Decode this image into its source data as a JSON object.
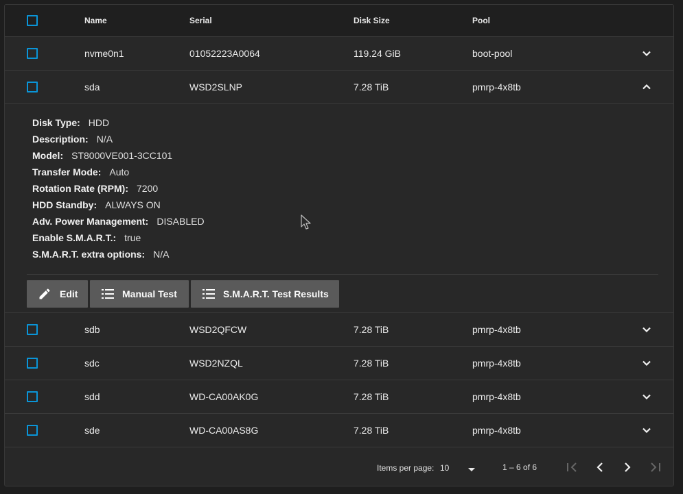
{
  "table": {
    "headers": {
      "name": "Name",
      "serial": "Serial",
      "disk_size": "Disk Size",
      "pool": "Pool"
    },
    "rows": [
      {
        "name": "nvme0n1",
        "serial": "01052223A0064",
        "disk_size": "119.24 GiB",
        "pool": "boot-pool",
        "expanded": false
      },
      {
        "name": "sda",
        "serial": "WSD2SLNP",
        "disk_size": "7.28 TiB",
        "pool": "pmrp-4x8tb",
        "expanded": true
      },
      {
        "name": "sdb",
        "serial": "WSD2QFCW",
        "disk_size": "7.28 TiB",
        "pool": "pmrp-4x8tb",
        "expanded": false
      },
      {
        "name": "sdc",
        "serial": "WSD2NZQL",
        "disk_size": "7.28 TiB",
        "pool": "pmrp-4x8tb",
        "expanded": false
      },
      {
        "name": "sdd",
        "serial": "WD-CA00AK0G",
        "disk_size": "7.28 TiB",
        "pool": "pmrp-4x8tb",
        "expanded": false
      },
      {
        "name": "sde",
        "serial": "WD-CA00AS8G",
        "disk_size": "7.28 TiB",
        "pool": "pmrp-4x8tb",
        "expanded": false
      }
    ]
  },
  "details": [
    {
      "key": "Disk Type:",
      "value": "HDD"
    },
    {
      "key": "Description:",
      "value": "N/A"
    },
    {
      "key": "Model:",
      "value": "ST8000VE001-3CC101"
    },
    {
      "key": "Transfer Mode:",
      "value": "Auto"
    },
    {
      "key": "Rotation Rate (RPM):",
      "value": "7200"
    },
    {
      "key": "HDD Standby:",
      "value": "ALWAYS ON"
    },
    {
      "key": "Adv. Power Management:",
      "value": "DISABLED"
    },
    {
      "key": "Enable S.M.A.R.T.:",
      "value": "true"
    },
    {
      "key": "S.M.A.R.T. extra options:",
      "value": "N/A"
    }
  ],
  "actions": {
    "edit": "Edit",
    "manual_test": "Manual Test",
    "smart_results": "S.M.A.R.T. Test Results"
  },
  "paginator": {
    "items_per_page_label": "Items per page:",
    "page_size": "10",
    "range": "1 – 6 of 6"
  },
  "colors": {
    "accent": "#0a95d8",
    "button": "#5a5a5a",
    "panel": "#282828",
    "header": "#1f1f1f"
  },
  "icons": {
    "expand": "chevron-down-icon",
    "collapse": "chevron-up-icon",
    "edit": "pencil-icon",
    "list": "list-icon"
  }
}
